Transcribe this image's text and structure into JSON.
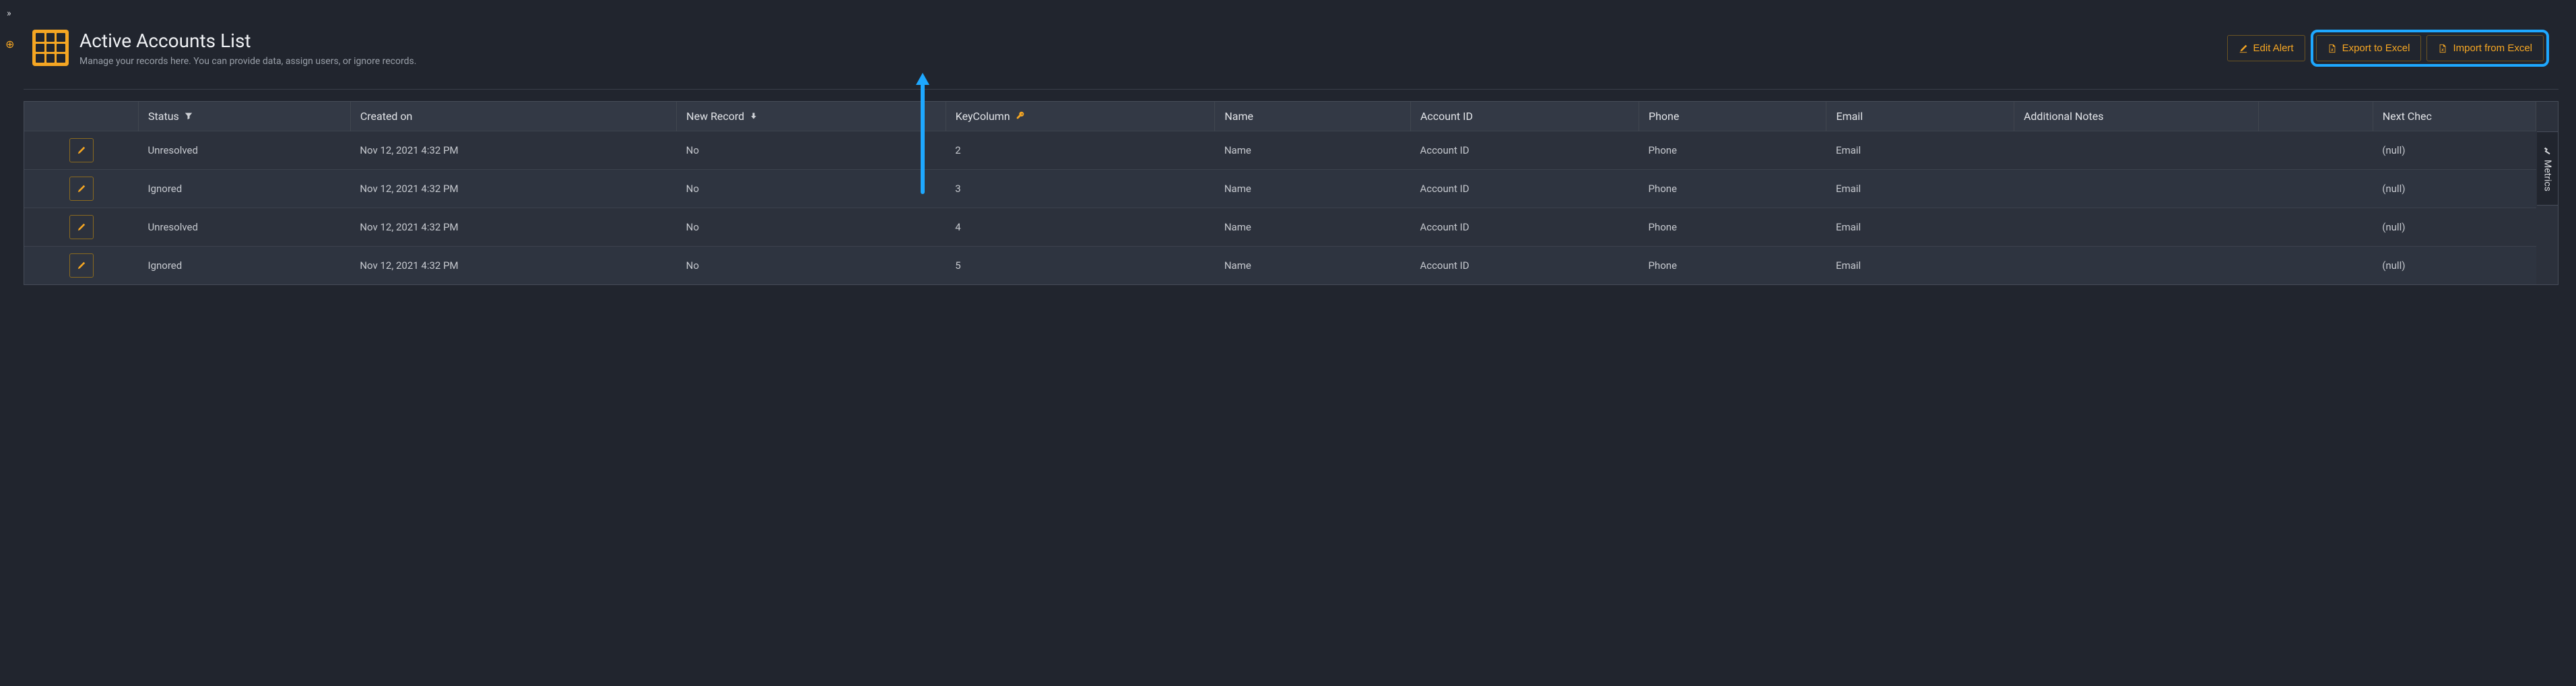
{
  "page_title": "Active Accounts List",
  "subtitle": "Manage your records here. You can provide data, assign users, or ignore records.",
  "buttons": {
    "edit_alert": "Edit Alert",
    "export": "Export to Excel",
    "import": "Import from Excel"
  },
  "columns": {
    "status": "Status",
    "created": "Created on",
    "new_record": "New Record",
    "key": "KeyColumn",
    "name": "Name",
    "account_id": "Account ID",
    "phone": "Phone",
    "email": "Email",
    "notes": "Additional Notes",
    "next_check": "Next Chec"
  },
  "rows": [
    {
      "status": "Unresolved",
      "created": "Nov 12, 2021 4:32 PM",
      "new_record": "No",
      "key": "2",
      "name": "Name",
      "account_id": "Account ID",
      "phone": "Phone",
      "email": "Email",
      "notes": "",
      "next_check": "(null)"
    },
    {
      "status": "Ignored",
      "created": "Nov 12, 2021 4:32 PM",
      "new_record": "No",
      "key": "3",
      "name": "Name",
      "account_id": "Account ID",
      "phone": "Phone",
      "email": "Email",
      "notes": "",
      "next_check": "(null)"
    },
    {
      "status": "Unresolved",
      "created": "Nov 12, 2021 4:32 PM",
      "new_record": "No",
      "key": "4",
      "name": "Name",
      "account_id": "Account ID",
      "phone": "Phone",
      "email": "Email",
      "notes": "",
      "next_check": "(null)"
    },
    {
      "status": "Ignored",
      "created": "Nov 12, 2021 4:32 PM",
      "new_record": "No",
      "key": "5",
      "name": "Name",
      "account_id": "Account ID",
      "phone": "Phone",
      "email": "Email",
      "notes": "",
      "next_check": "(null)"
    }
  ],
  "metrics_label": "Metrics"
}
